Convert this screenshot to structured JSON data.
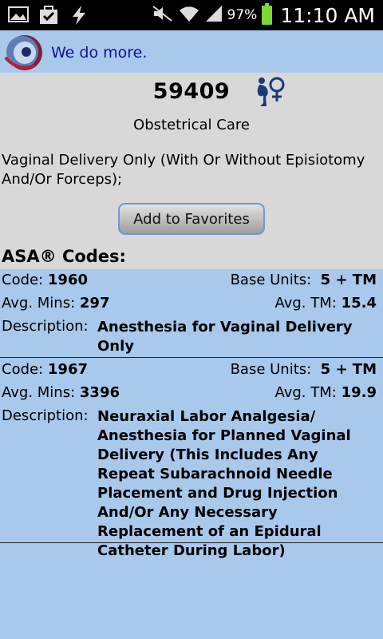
{
  "status_bar": {
    "battery_percent": "97%",
    "time": "11:10 AM"
  },
  "header": {
    "tagline": "We do more."
  },
  "procedure": {
    "code": "59409",
    "category": "Obstetrical Care",
    "description": "Vaginal Delivery Only (With Or Without Episiotomy And/Or  Forceps);",
    "favorites_button": "Add to Favorites"
  },
  "asa_title": "ASA® Codes:",
  "labels": {
    "code": "Code:",
    "base_units": "Base Units:",
    "avg_mins": "Avg. Mins:",
    "avg_tm": "Avg. TM:",
    "description": "Description:"
  },
  "asa_codes": [
    {
      "code": "1960",
      "base_units": "5 + TM",
      "avg_mins": "297",
      "avg_tm": "15.4",
      "description": "Anesthesia for Vaginal Delivery Only"
    },
    {
      "code": "1967",
      "base_units": "5 + TM",
      "avg_mins": "3396",
      "avg_tm": "19.9",
      "description": "Neuraxial Labor Analgesia/ Anesthesia for Planned Vaginal Delivery (This Includes Any Repeat Subarachnoid Needle Placement and Drug Injection And/Or Any Necessary Replacement of an Epidural Catheter During Labor)"
    }
  ]
}
